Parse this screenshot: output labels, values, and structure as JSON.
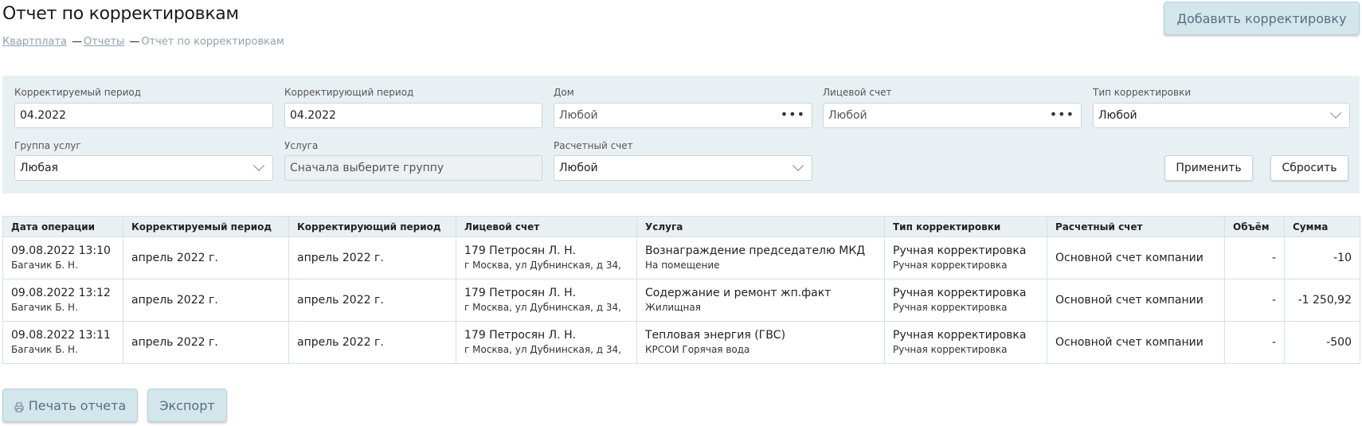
{
  "page": {
    "title": "Отчет по корректировкам",
    "add_button": "Добавить корректировку"
  },
  "breadcrumb": {
    "items": [
      "Квартплата",
      "Отчеты"
    ],
    "separator": "—",
    "current": "Отчет по корректировкам"
  },
  "filters": {
    "corrected_period": {
      "label": "Корректируемый период",
      "value": "04.2022"
    },
    "correcting_period": {
      "label": "Корректирующий период",
      "value": "04.2022"
    },
    "house": {
      "label": "Дом",
      "value": "Любой"
    },
    "account": {
      "label": "Лицевой счет",
      "value": "Любой"
    },
    "correction_type": {
      "label": "Тип корректировки",
      "value": "Любой"
    },
    "service_group": {
      "label": "Группа услуг",
      "value": "Любая"
    },
    "service": {
      "label": "Услуга",
      "placeholder": "Сначала выберите группу"
    },
    "settlement_account": {
      "label": "Расчетный счет",
      "value": "Любой"
    },
    "apply_button": "Применить",
    "reset_button": "Сбросить"
  },
  "table": {
    "columns": [
      "Дата операции",
      "Корректируемый период",
      "Корректирующий период",
      "Лицевой счет",
      "Услуга",
      "Тип корректировки",
      "Расчетный счет",
      "Объём",
      "Сумма"
    ],
    "rows": [
      {
        "date": "09.08.2022 13:10",
        "user": "Багачик Б. Н.",
        "corrected": "апрель 2022 г.",
        "correcting": "апрель 2022 г.",
        "account": "179 Петросян Л. Н.",
        "address": "г Москва, ул Дубнинская, д 34,",
        "service": "Вознаграждение председателю МКД",
        "service_sub": "На помещение",
        "type": "Ручная корректировка",
        "type_sub": "Ручная корректировка",
        "settlement": "Основной счет компании",
        "volume": "-",
        "sum": "-10"
      },
      {
        "date": "09.08.2022 13:12",
        "user": "Багачик Б. Н.",
        "corrected": "апрель 2022 г.",
        "correcting": "апрель 2022 г.",
        "account": "179 Петросян Л. Н.",
        "address": "г Москва, ул Дубнинская, д 34,",
        "service": "Содержание и ремонт жп.факт",
        "service_sub": "Жилищная",
        "type": "Ручная корректировка",
        "type_sub": "Ручная корректировка",
        "settlement": "Основной счет компании",
        "volume": "-",
        "sum": "-1 250,92"
      },
      {
        "date": "09.08.2022 13:11",
        "user": "Багачик Б. Н.",
        "corrected": "апрель 2022 г.",
        "correcting": "апрель 2022 г.",
        "account": "179 Петросян Л. Н.",
        "address": "г Москва, ул Дубнинская, д 34,",
        "service": "Тепловая энергия (ГВС)",
        "service_sub": "КРСОИ Горячая вода",
        "type": "Ручная корректировка",
        "type_sub": "Ручная корректировка",
        "settlement": "Основной счет компании",
        "volume": "-",
        "sum": "-500"
      }
    ]
  },
  "footer": {
    "print_button": "Печать отчета",
    "export_button": "Экспорт"
  },
  "icons": {
    "print": "print-icon",
    "dots": "more-dots-icon",
    "dropdown": "chevron-down-icon"
  }
}
